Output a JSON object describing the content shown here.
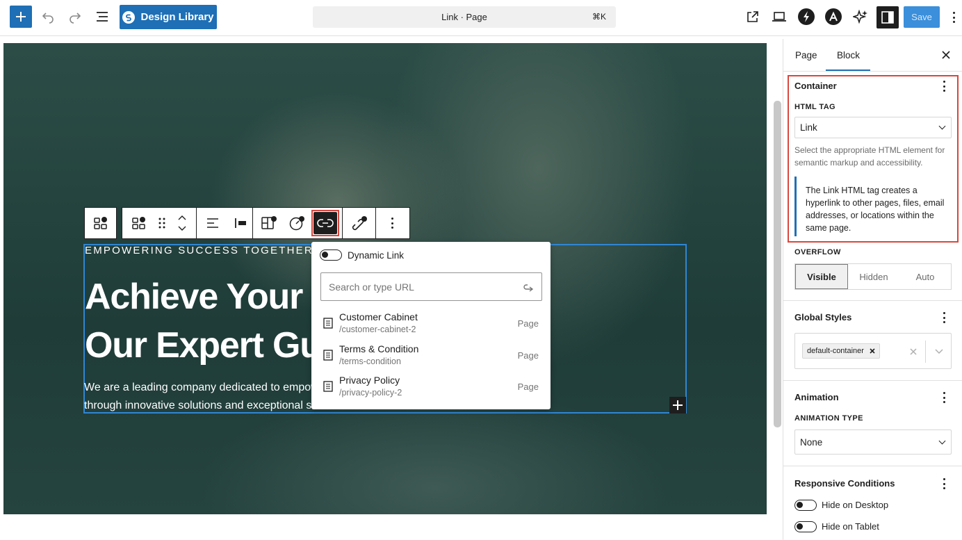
{
  "header": {
    "library_label": "Design Library",
    "command_label": "Link · Page",
    "command_shortcut": "⌘K",
    "save_label": "Save"
  },
  "block_toolbar": {
    "icons": [
      "container-icon",
      "container-select-icon",
      "drag-handle-icon",
      "move-arrows-icon",
      "align-left-icon",
      "justify-icon",
      "style-copy-icon",
      "settings-dial-icon",
      "link-icon",
      "dynamic-link-icon",
      "more-icon"
    ]
  },
  "hero": {
    "eyebrow": "EMPOWERING SUCCESS TOGETHER",
    "headline_line1": "Achieve Your",
    "headline_line2": "Our Expert Gu",
    "para_line1": "We are a leading company dedicated to empow",
    "para_line2": "through innovative solutions and exceptional se"
  },
  "link_popover": {
    "dynamic_label": "Dynamic Link",
    "search_placeholder": "Search or type URL",
    "results": [
      {
        "title": "Customer Cabinet",
        "url": "/customer-cabinet-2",
        "kind": "Page"
      },
      {
        "title": "Terms & Condition",
        "url": "/terms-condition",
        "kind": "Page"
      },
      {
        "title": "Privacy Policy",
        "url": "/privacy-policy-2",
        "kind": "Page"
      }
    ]
  },
  "sidebar": {
    "tabs": [
      "Page",
      "Block"
    ],
    "container": {
      "title": "Container",
      "html_tag_label": "HTML TAG",
      "html_tag_value": "Link",
      "help": "Select the appropriate HTML element for semantic markup and accessibility.",
      "note": "The Link HTML tag creates a hyperlink to other pages, files, email addresses, or locations within the same page."
    },
    "overflow": {
      "label": "OVERFLOW",
      "options": [
        "Visible",
        "Hidden",
        "Auto"
      ],
      "selected": "Visible"
    },
    "global_styles": {
      "title": "Global Styles",
      "chip": "default-container"
    },
    "animation": {
      "title": "Animation",
      "type_label": "ANIMATION TYPE",
      "value": "None"
    },
    "responsive": {
      "title": "Responsive Conditions",
      "items": [
        "Hide on Desktop",
        "Hide on Tablet"
      ]
    }
  },
  "colors": {
    "accent": "#1e6fb5",
    "highlight": "#d9453d",
    "selection": "#2f86d4"
  }
}
